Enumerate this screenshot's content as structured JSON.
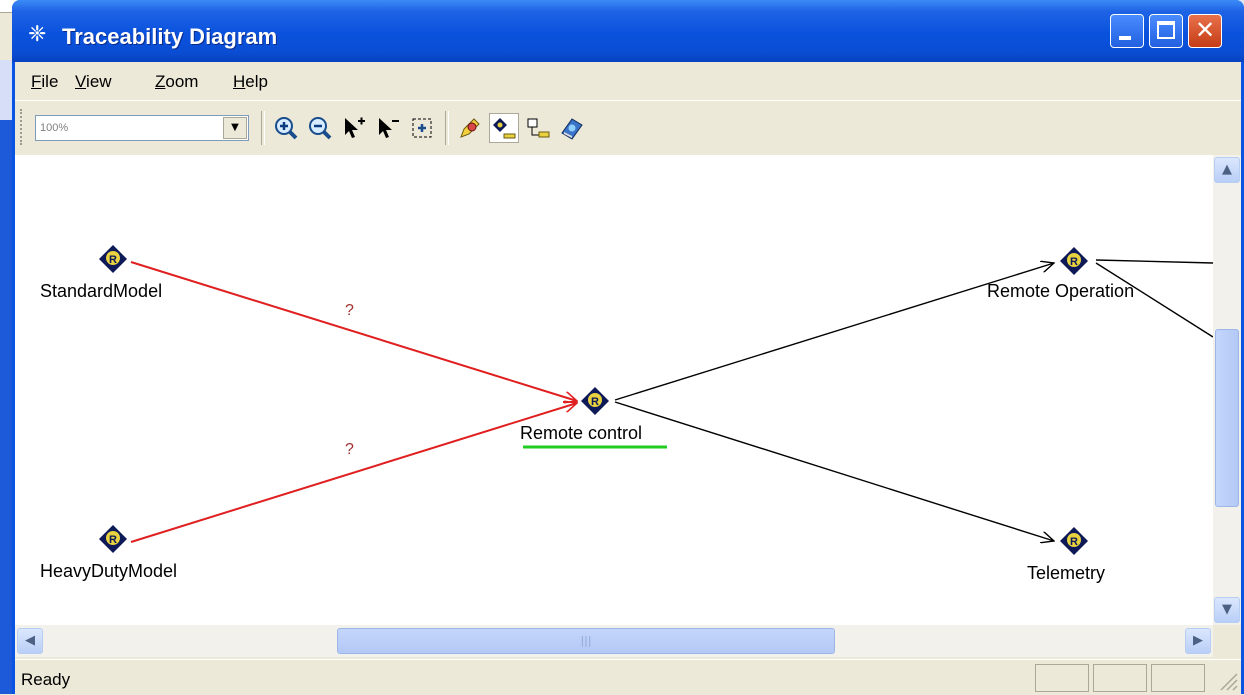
{
  "window": {
    "title": "Traceability Diagram"
  },
  "menu": {
    "file": "F",
    "file_rest": "ile",
    "view": "V",
    "view_rest": "iew",
    "zoom": "Z",
    "zoom_rest": "oom",
    "help": "H",
    "help_rest": "elp"
  },
  "toolbar": {
    "zoom_value": "100%"
  },
  "diagram": {
    "nodes": {
      "standard_model": "StandardModel",
      "heavy_duty_model": "HeavyDutyModel",
      "remote_control": "Remote control",
      "remote_operation": "Remote Operation",
      "telemetry": "Telemetry"
    },
    "node_glyph": "R",
    "suspect_mark": "?",
    "colors": {
      "suspect_link": "#e02020",
      "link": "#000000",
      "node_fill": "#0d1a57",
      "node_letter_bg": "#e8d240",
      "selection": "#22cc22"
    }
  },
  "status": {
    "text": "Ready"
  },
  "icons": [
    "app-network-icon",
    "zoom-in-icon",
    "zoom-out-icon",
    "select-add-icon",
    "select-remove-icon",
    "fit-icon",
    "pencil-icon",
    "node-icon",
    "label-icon",
    "book-icon"
  ]
}
